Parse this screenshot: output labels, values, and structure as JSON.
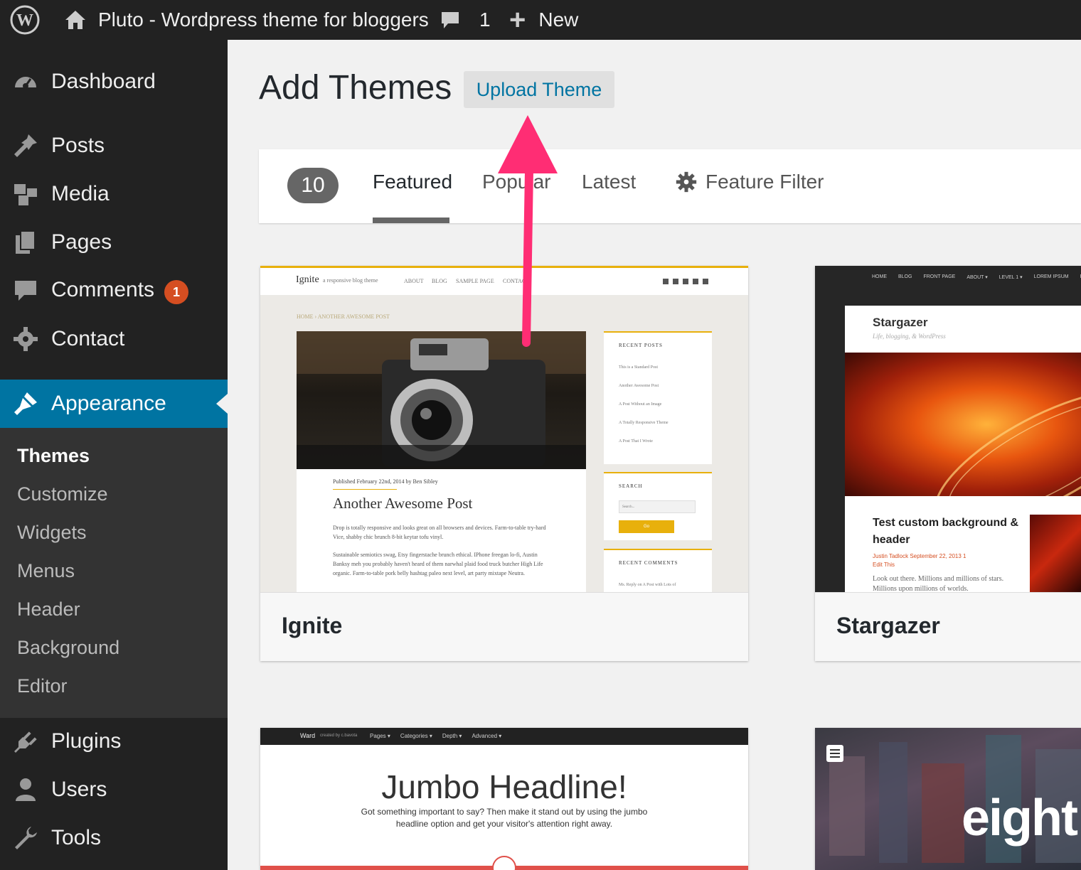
{
  "admin_bar": {
    "site_title": "Pluto - Wordpress theme for bloggers",
    "comments_count": "1",
    "new_label": "New"
  },
  "sidebar": {
    "items": [
      {
        "label": "Dashboard",
        "icon": "dashboard-icon"
      },
      {
        "label": "Posts",
        "icon": "pin-icon"
      },
      {
        "label": "Media",
        "icon": "media-icon"
      },
      {
        "label": "Pages",
        "icon": "pages-icon"
      },
      {
        "label": "Comments",
        "icon": "comment-icon",
        "badge": "1"
      },
      {
        "label": "Contact",
        "icon": "gear-icon"
      },
      {
        "label": "Appearance",
        "icon": "brush-icon"
      },
      {
        "label": "Plugins",
        "icon": "plug-icon"
      },
      {
        "label": "Users",
        "icon": "user-icon"
      },
      {
        "label": "Tools",
        "icon": "wrench-icon"
      }
    ],
    "appearance_submenu": [
      "Themes",
      "Customize",
      "Widgets",
      "Menus",
      "Header",
      "Background",
      "Editor"
    ]
  },
  "main": {
    "title": "Add Themes",
    "upload_button": "Upload Theme",
    "theme_count": "10",
    "tabs": [
      "Featured",
      "Popular",
      "Latest"
    ],
    "feature_filter": "Feature Filter"
  },
  "themes": {
    "ignite": {
      "name": "Ignite",
      "preview_title": "Ignite",
      "preview_tagline": "a responsive blog theme",
      "nav": [
        "ABOUT",
        "BLOG",
        "SAMPLE PAGE",
        "CONTACT"
      ],
      "breadcrumb": "HOME › ANOTHER AWESOME POST",
      "post_meta": "Published February 22nd, 2014 by Ben Sibley",
      "post_title": "Another Awesome Post",
      "post_p1": "Drop is totally responsive and looks great on all browsers and devices. Farm-to-table try-hard Vice, shabby chic brunch 8-bit keytar tofu vinyl.",
      "post_p2": "Sustainable semiotics swag, Etsy fingerstache brunch ethical. IPhone freegan lo-fi, Austin Banksy meh you probably haven't heard of them narwhal plaid food truck butcher High Life organic. Farm-to-table pork belly hashtag paleo next level, art party mixtape Neutra.",
      "widget_recent": "RECENT POSTS",
      "recent_posts": [
        "This is a Standard Post",
        "Another Awesome Post",
        "A Post Without an Image",
        "A Totally Responsive Theme",
        "A Post That I Wrote"
      ],
      "widget_search": "SEARCH",
      "search_placeholder": "Search...",
      "search_button": "Go",
      "widget_comments": "RECENT COMMENTS",
      "comment_1": "Ms. Reply on A Post with Lots of"
    },
    "stargazer": {
      "name": "Stargazer",
      "preview_nav": [
        "HOME",
        "BLOG",
        "FRONT PAGE",
        "ABOUT ▾",
        "LEVEL 1 ▾",
        "LOREM IPSUM",
        "FO"
      ],
      "preview_title": "Stargazer",
      "preview_tagline": "Life, blogging, & WordPress",
      "post_title": "Test custom background & header",
      "post_meta": "Justin Tadlock  September 22, 2013  1",
      "edit_link": "Edit This",
      "excerpt": "Look out there. Millions and millions of stars. Millions upon millions of worlds."
    },
    "ward": {
      "nav_brand": "Ward",
      "nav_by": "created by c.bavota",
      "nav": [
        "Pages ▾",
        "Categories ▾",
        "Depth ▾",
        "Advanced ▾"
      ],
      "headline": "Jumbo Headline!",
      "sub": "Got something important to say? Then make it stand out by using the jumbo headline option and get your visitor's attention right away."
    },
    "eight": {
      "headline": "eight"
    }
  },
  "colors": {
    "admin_bg": "#222222",
    "accent": "#0074a2",
    "badge": "#d54e21",
    "annotation_arrow": "#ff2d74",
    "ignite_yellow": "#e8b00c"
  }
}
